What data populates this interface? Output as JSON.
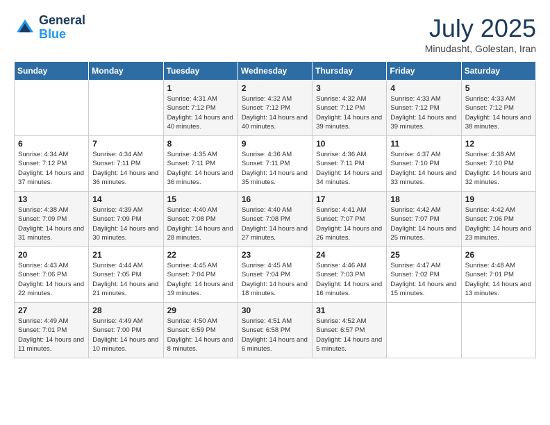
{
  "header": {
    "logo_line1": "General",
    "logo_line2": "Blue",
    "month_title": "July 2025",
    "location": "Minudasht, Golestan, Iran"
  },
  "weekdays": [
    "Sunday",
    "Monday",
    "Tuesday",
    "Wednesday",
    "Thursday",
    "Friday",
    "Saturday"
  ],
  "weeks": [
    [
      {
        "day": "",
        "text": ""
      },
      {
        "day": "",
        "text": ""
      },
      {
        "day": "1",
        "text": "Sunrise: 4:31 AM\nSunset: 7:12 PM\nDaylight: 14 hours and 40 minutes."
      },
      {
        "day": "2",
        "text": "Sunrise: 4:32 AM\nSunset: 7:12 PM\nDaylight: 14 hours and 40 minutes."
      },
      {
        "day": "3",
        "text": "Sunrise: 4:32 AM\nSunset: 7:12 PM\nDaylight: 14 hours and 39 minutes."
      },
      {
        "day": "4",
        "text": "Sunrise: 4:33 AM\nSunset: 7:12 PM\nDaylight: 14 hours and 39 minutes."
      },
      {
        "day": "5",
        "text": "Sunrise: 4:33 AM\nSunset: 7:12 PM\nDaylight: 14 hours and 38 minutes."
      }
    ],
    [
      {
        "day": "6",
        "text": "Sunrise: 4:34 AM\nSunset: 7:12 PM\nDaylight: 14 hours and 37 minutes."
      },
      {
        "day": "7",
        "text": "Sunrise: 4:34 AM\nSunset: 7:11 PM\nDaylight: 14 hours and 36 minutes."
      },
      {
        "day": "8",
        "text": "Sunrise: 4:35 AM\nSunset: 7:11 PM\nDaylight: 14 hours and 36 minutes."
      },
      {
        "day": "9",
        "text": "Sunrise: 4:36 AM\nSunset: 7:11 PM\nDaylight: 14 hours and 35 minutes."
      },
      {
        "day": "10",
        "text": "Sunrise: 4:36 AM\nSunset: 7:11 PM\nDaylight: 14 hours and 34 minutes."
      },
      {
        "day": "11",
        "text": "Sunrise: 4:37 AM\nSunset: 7:10 PM\nDaylight: 14 hours and 33 minutes."
      },
      {
        "day": "12",
        "text": "Sunrise: 4:38 AM\nSunset: 7:10 PM\nDaylight: 14 hours and 32 minutes."
      }
    ],
    [
      {
        "day": "13",
        "text": "Sunrise: 4:38 AM\nSunset: 7:09 PM\nDaylight: 14 hours and 31 minutes."
      },
      {
        "day": "14",
        "text": "Sunrise: 4:39 AM\nSunset: 7:09 PM\nDaylight: 14 hours and 30 minutes."
      },
      {
        "day": "15",
        "text": "Sunrise: 4:40 AM\nSunset: 7:08 PM\nDaylight: 14 hours and 28 minutes."
      },
      {
        "day": "16",
        "text": "Sunrise: 4:40 AM\nSunset: 7:08 PM\nDaylight: 14 hours and 27 minutes."
      },
      {
        "day": "17",
        "text": "Sunrise: 4:41 AM\nSunset: 7:07 PM\nDaylight: 14 hours and 26 minutes."
      },
      {
        "day": "18",
        "text": "Sunrise: 4:42 AM\nSunset: 7:07 PM\nDaylight: 14 hours and 25 minutes."
      },
      {
        "day": "19",
        "text": "Sunrise: 4:42 AM\nSunset: 7:06 PM\nDaylight: 14 hours and 23 minutes."
      }
    ],
    [
      {
        "day": "20",
        "text": "Sunrise: 4:43 AM\nSunset: 7:06 PM\nDaylight: 14 hours and 22 minutes."
      },
      {
        "day": "21",
        "text": "Sunrise: 4:44 AM\nSunset: 7:05 PM\nDaylight: 14 hours and 21 minutes."
      },
      {
        "day": "22",
        "text": "Sunrise: 4:45 AM\nSunset: 7:04 PM\nDaylight: 14 hours and 19 minutes."
      },
      {
        "day": "23",
        "text": "Sunrise: 4:45 AM\nSunset: 7:04 PM\nDaylight: 14 hours and 18 minutes."
      },
      {
        "day": "24",
        "text": "Sunrise: 4:46 AM\nSunset: 7:03 PM\nDaylight: 14 hours and 16 minutes."
      },
      {
        "day": "25",
        "text": "Sunrise: 4:47 AM\nSunset: 7:02 PM\nDaylight: 14 hours and 15 minutes."
      },
      {
        "day": "26",
        "text": "Sunrise: 4:48 AM\nSunset: 7:01 PM\nDaylight: 14 hours and 13 minutes."
      }
    ],
    [
      {
        "day": "27",
        "text": "Sunrise: 4:49 AM\nSunset: 7:01 PM\nDaylight: 14 hours and 11 minutes."
      },
      {
        "day": "28",
        "text": "Sunrise: 4:49 AM\nSunset: 7:00 PM\nDaylight: 14 hours and 10 minutes."
      },
      {
        "day": "29",
        "text": "Sunrise: 4:50 AM\nSunset: 6:59 PM\nDaylight: 14 hours and 8 minutes."
      },
      {
        "day": "30",
        "text": "Sunrise: 4:51 AM\nSunset: 6:58 PM\nDaylight: 14 hours and 6 minutes."
      },
      {
        "day": "31",
        "text": "Sunrise: 4:52 AM\nSunset: 6:57 PM\nDaylight: 14 hours and 5 minutes."
      },
      {
        "day": "",
        "text": ""
      },
      {
        "day": "",
        "text": ""
      }
    ]
  ]
}
